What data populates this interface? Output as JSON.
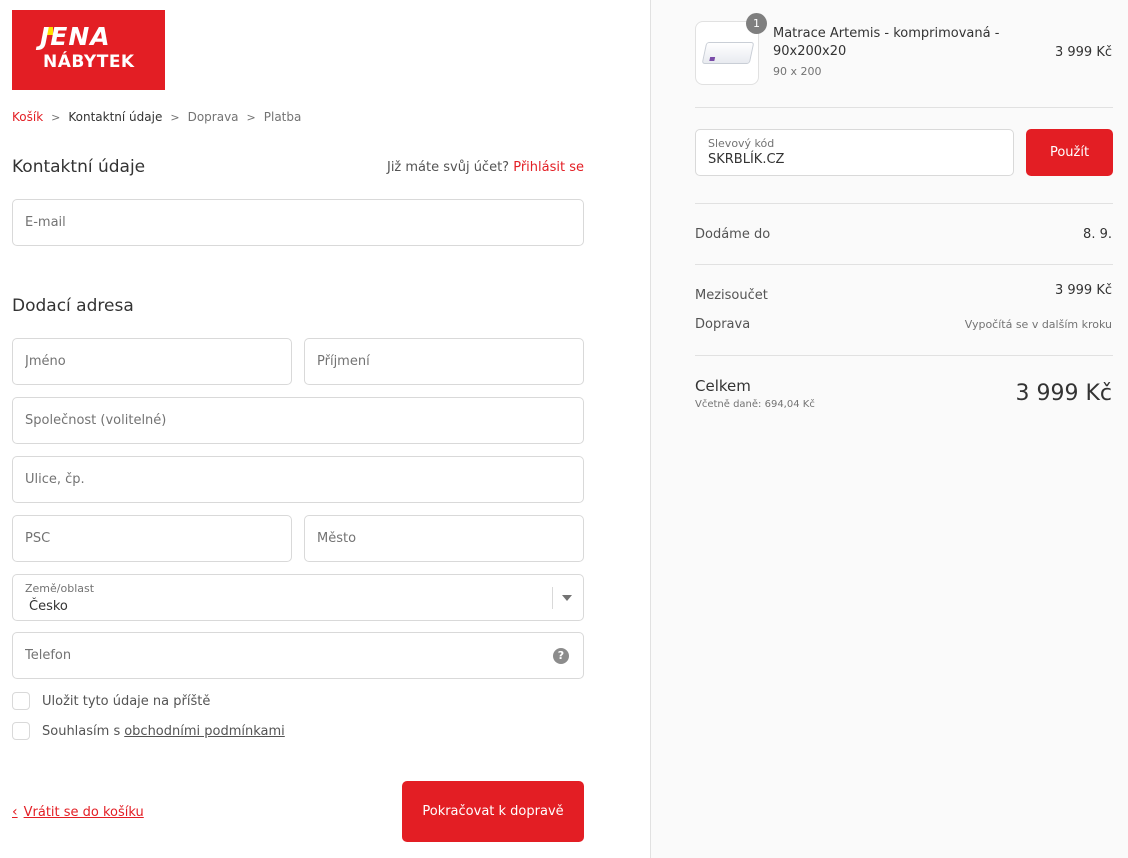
{
  "brand": {
    "line1": "JENA",
    "line2": "NÁBYTEK",
    "color": "#e31e24",
    "accent": "#ffe000"
  },
  "breadcrumb": [
    {
      "label": "Košík",
      "state": "link"
    },
    {
      "label": "Kontaktní údaje",
      "state": "current"
    },
    {
      "label": "Doprava",
      "state": "upcoming"
    },
    {
      "label": "Platba",
      "state": "upcoming"
    }
  ],
  "contact": {
    "title": "Kontaktní údaje",
    "login_prompt": "Již máte svůj účet?",
    "login_link": "Přihlásit se",
    "email_placeholder": "E-mail"
  },
  "address": {
    "title": "Dodací adresa",
    "first_name_placeholder": "Jméno",
    "last_name_placeholder": "Příjmení",
    "company_placeholder": "Společnost (volitelné)",
    "street_placeholder": "Ulice, čp.",
    "zip_placeholder": "PSČ",
    "city_placeholder": "Město",
    "country_label": "Země/oblast",
    "country_value": "Česko",
    "phone_placeholder": "Telefon",
    "help_glyph": "?"
  },
  "checkboxes": {
    "save_label": "Uložit tyto údaje na příště",
    "terms_prefix": "Souhlasím s",
    "terms_link": "obchodními podmínkami"
  },
  "actions": {
    "back_glyph": "‹",
    "back_label": "Vrátit se do košíku",
    "continue_label": "Pokračovat k dopravě"
  },
  "summary": {
    "product": {
      "quantity": "1",
      "name": "Matrace Artemis - komprimovaná - 90x200x20",
      "variant": "90 x 200",
      "price": "3 999 Kč"
    },
    "discount": {
      "label": "Slevový kód",
      "value": "SKRBLÍK.CZ",
      "apply_label": "Použít"
    },
    "delivery": {
      "label": "Dodáme do",
      "value": "8. 9."
    },
    "subtotal": {
      "label": "Mezisoučet",
      "value": "3 999 Kč"
    },
    "shipping": {
      "label": "Doprava",
      "value": "Vypočítá se v dalším kroku"
    },
    "total": {
      "label": "Celkem",
      "tax_note": "Včetně daně: 694,04 Kč",
      "value": "3 999 Kč"
    }
  }
}
